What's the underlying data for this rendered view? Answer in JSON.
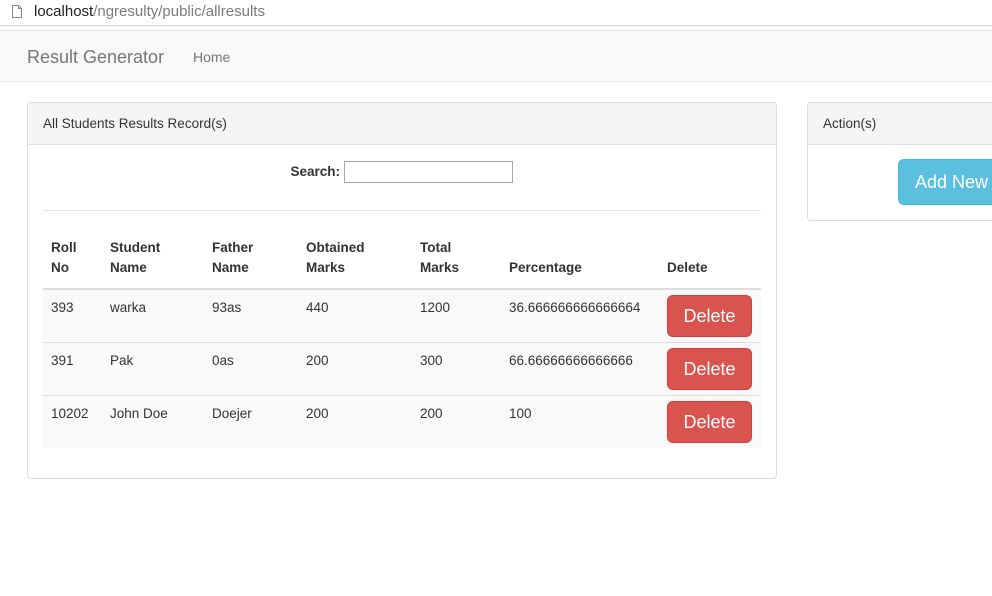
{
  "browser": {
    "url_host": "localhost",
    "url_path": "/ngresulty/public/allresults"
  },
  "navbar": {
    "brand": "Result Generator",
    "home_label": "Home"
  },
  "results_panel": {
    "title": "All Students Results Record(s)",
    "search_label": "Search:",
    "search_value": "",
    "columns": [
      [
        "Roll",
        "No"
      ],
      [
        "Student",
        "Name"
      ],
      [
        "Father",
        "Name"
      ],
      [
        "Obtained",
        "Marks"
      ],
      [
        "Total",
        "Marks"
      ],
      [
        "Percentage",
        ""
      ],
      [
        "Delete",
        ""
      ]
    ],
    "rows": [
      {
        "roll": "393",
        "student": "warka",
        "father": "93as",
        "obtained": "440",
        "total": "1200",
        "percentage": "36.666666666666664",
        "delete_label": "Delete"
      },
      {
        "roll": "391",
        "student": "Pak",
        "father": "0as",
        "obtained": "200",
        "total": "300",
        "percentage": "66.66666666666666",
        "delete_label": "Delete"
      },
      {
        "roll": "10202",
        "student": "John Doe",
        "father": "Doejer",
        "obtained": "200",
        "total": "200",
        "percentage": "100",
        "delete_label": "Delete"
      }
    ]
  },
  "actions_panel": {
    "title": "Action(s)",
    "add_new_label": "Add New"
  },
  "colors": {
    "danger": "#d9534f",
    "info": "#5bc0de",
    "navbar_bg": "#f8f8f8"
  }
}
